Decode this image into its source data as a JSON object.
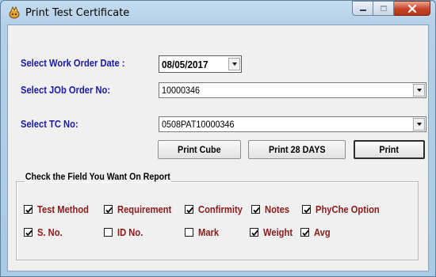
{
  "window": {
    "title": "Print Test Certificate"
  },
  "form": {
    "work_order_date_label": "Select Work Order Date :",
    "work_order_date_value": "08/05/2017",
    "job_order_label": "Select JOb Order No:",
    "job_order_value": "10000346",
    "tc_label": "Select TC No:",
    "tc_value": "0508PAT10000346"
  },
  "buttons": {
    "print_cube": "Print Cube",
    "print_28_days": "Print 28 DAYS",
    "print": "Print"
  },
  "fields_group": {
    "title": "Check the Field You Want On Report",
    "checkboxes": [
      {
        "label": "Test Method",
        "checked": true
      },
      {
        "label": "Requirement",
        "checked": true
      },
      {
        "label": "Confirmity",
        "checked": true
      },
      {
        "label": "Notes",
        "checked": true
      },
      {
        "label": "PhyChe Option",
        "checked": true
      },
      {
        "label": "S. No.",
        "checked": true
      },
      {
        "label": "ID No.",
        "checked": false
      },
      {
        "label": "Mark",
        "checked": false
      },
      {
        "label": "Weight",
        "checked": true
      },
      {
        "label": "Avg",
        "checked": true
      }
    ]
  },
  "colors": {
    "label_blue": "#1a1aa6",
    "checkbox_label_red": "#8b1a1a",
    "close_button_red": "#c7432a"
  }
}
